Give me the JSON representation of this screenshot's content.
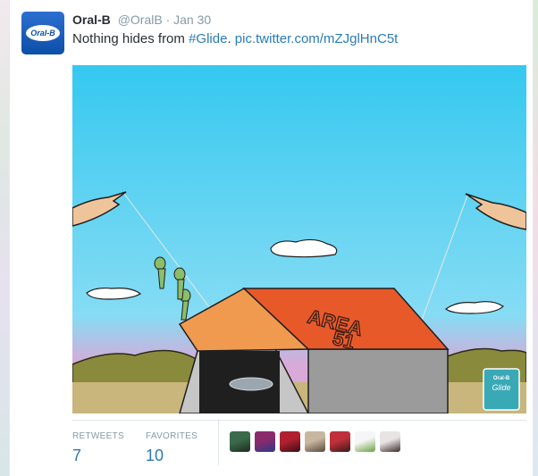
{
  "tweet": {
    "author_name": "Oral-B",
    "handle": "@OralB",
    "separator": "·",
    "time": "Jan 30",
    "text_prefix": "Nothing hides from ",
    "hashtag": "#Glide",
    "text_mid": ". ",
    "link": "pic.twitter.com/mZJglHnC5t",
    "avatar_text": "Oral-B"
  },
  "image": {
    "sign_line1": "AREA",
    "sign_line2": "51",
    "box_brand": "Oral-B",
    "box_product": "Glide"
  },
  "stats": {
    "retweets_label": "RETWEETS",
    "retweets_value": "7",
    "favorites_label": "FAVORITES",
    "favorites_value": "10"
  },
  "faces": [
    {
      "name": "favoriter-avatar-1",
      "colors": [
        "#3a6a4a",
        "#1e2a20"
      ]
    },
    {
      "name": "favoriter-avatar-2",
      "colors": [
        "#8a2a6a",
        "#2a3a8a"
      ]
    },
    {
      "name": "favoriter-avatar-3",
      "colors": [
        "#b02030",
        "#3a0e14"
      ]
    },
    {
      "name": "favoriter-avatar-4",
      "colors": [
        "#c8b6a0",
        "#5a4a3c"
      ]
    },
    {
      "name": "favoriter-avatar-5",
      "colors": [
        "#c0303a",
        "#3a1a18"
      ]
    },
    {
      "name": "favoriter-avatar-6",
      "colors": [
        "#f6f6f6",
        "#6aa040"
      ]
    },
    {
      "name": "favoriter-avatar-7",
      "colors": [
        "#e9e4e4",
        "#3a2a2a"
      ]
    }
  ]
}
